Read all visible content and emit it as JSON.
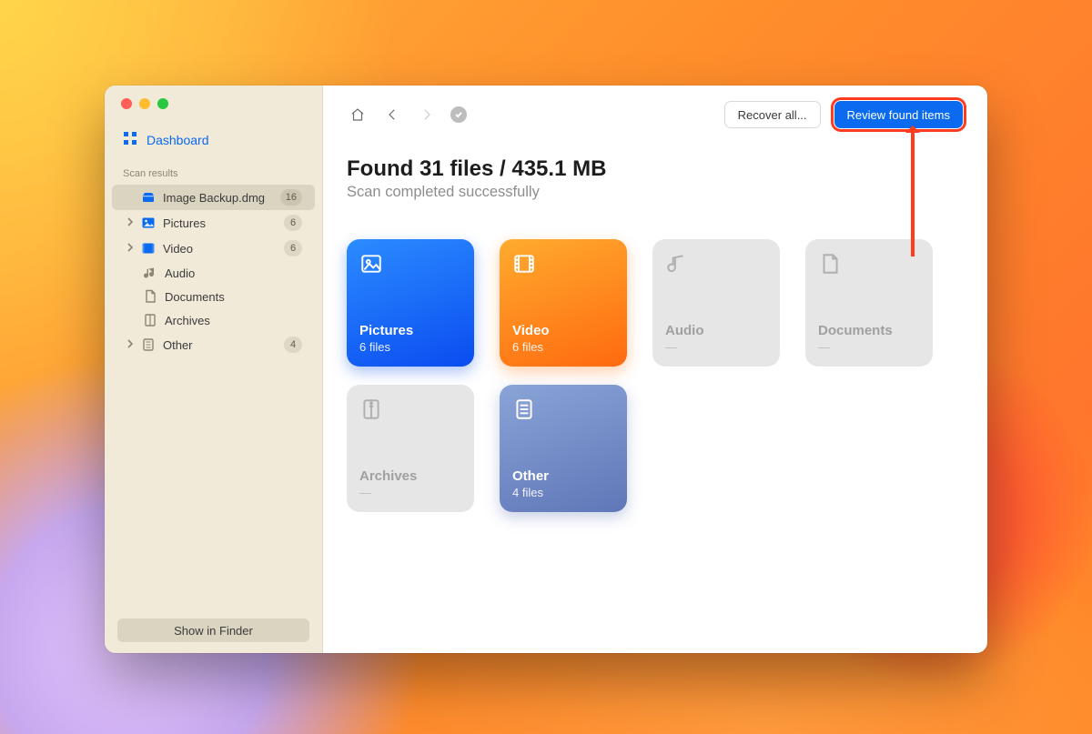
{
  "sidebar": {
    "dashboard_label": "Dashboard",
    "section_label": "Scan results",
    "items": [
      {
        "label": "Image Backup.dmg",
        "count": "16"
      },
      {
        "label": "Pictures",
        "count": "6"
      },
      {
        "label": "Video",
        "count": "6"
      },
      {
        "label": "Audio"
      },
      {
        "label": "Documents"
      },
      {
        "label": "Archives"
      },
      {
        "label": "Other",
        "count": "4"
      }
    ],
    "finder_button": "Show in Finder"
  },
  "toolbar": {
    "recover_all": "Recover all...",
    "review": "Review found items"
  },
  "headline": {
    "title": "Found 31 files / 435.1 MB",
    "subtitle": "Scan completed successfully"
  },
  "tiles": {
    "pictures": {
      "label": "Pictures",
      "count": "6 files"
    },
    "video": {
      "label": "Video",
      "count": "6 files"
    },
    "audio": {
      "label": "Audio",
      "count": "—"
    },
    "documents": {
      "label": "Documents",
      "count": "—"
    },
    "archives": {
      "label": "Archives",
      "count": "—"
    },
    "other": {
      "label": "Other",
      "count": "4 files"
    }
  }
}
